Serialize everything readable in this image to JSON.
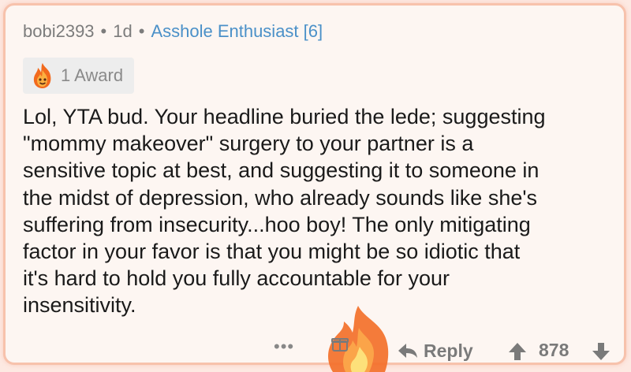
{
  "comment": {
    "author": "bobi2393",
    "separator": "•",
    "age": "1d",
    "flair": "Asshole Enthusiast [6]",
    "award_label": "1 Award",
    "body": "Lol, YTA bud. Your headline buried the lede; suggesting\n\"mommy makeover\" surgery to your partner is a\nsensitive topic at best, and suggesting it to someone in\nthe midst of depression, who already sounds like she's\nsuffering from insecurity...hoo boy! The only mitigating\nfactor in your favor is that you might be so idiotic that\nit's hard to hold you fully accountable for your\ninsensitivity."
  },
  "actions": {
    "more_label": "•••",
    "reply_label": "Reply",
    "score": "878"
  },
  "icons": {
    "award": "flame-face-award-icon",
    "overlay": "flame-emoji-icon",
    "gift": "gift-icon",
    "reply": "reply-arrow-icon",
    "upvote": "upvote-arrow-icon",
    "downvote": "downvote-arrow-icon"
  },
  "colors": {
    "background": "#fdf6f2",
    "border": "#f7c2ac",
    "flair": "#4a90c8",
    "meta": "#7c7c7c"
  }
}
